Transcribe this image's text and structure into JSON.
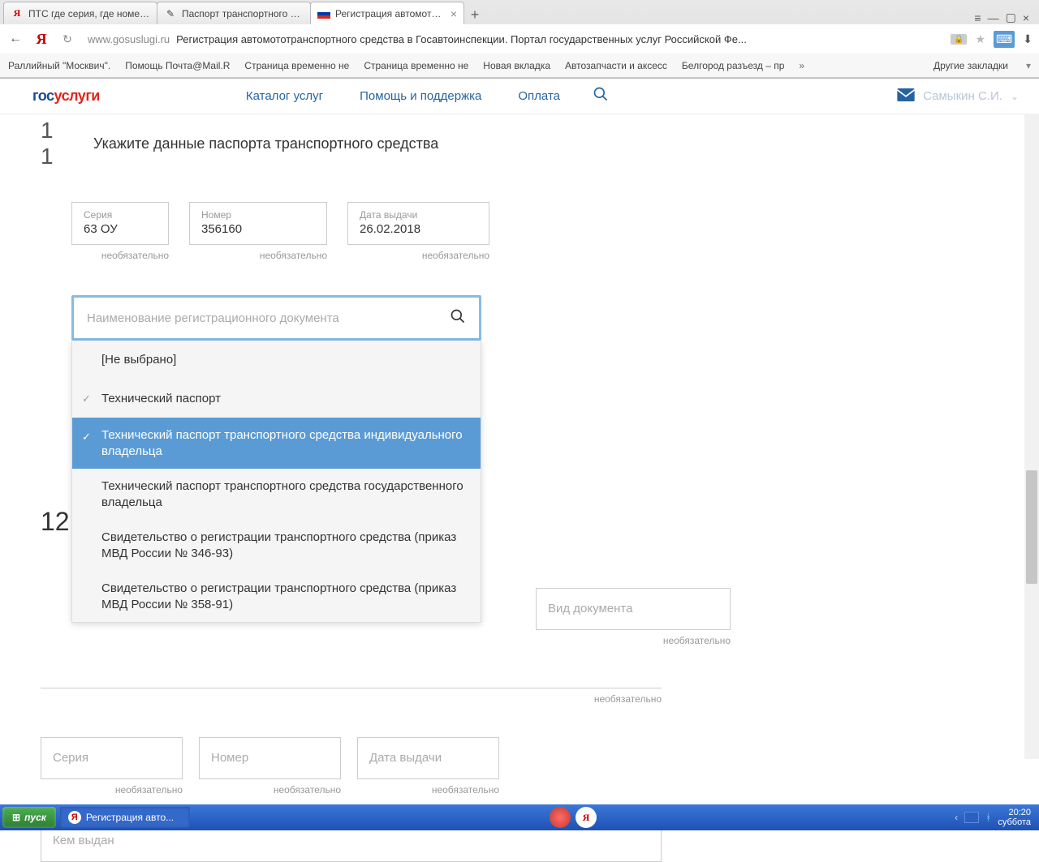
{
  "browser": {
    "tabs": [
      {
        "title": "ПТС где серия, где номер –",
        "favicon": "Я",
        "favColor": "#c00"
      },
      {
        "title": "Паспорт транспортного сре",
        "favicon": "✎",
        "favColor": "#333"
      },
      {
        "title": "Регистрация автомототр",
        "favicon": "🇷🇺",
        "favColor": ""
      }
    ],
    "url_host": "www.gosuslugi.ru",
    "url_title": "Регистрация автомототранспортного средства в Госавтоинспекции. Портал государственных услуг Российской Фе...",
    "bookmarks": [
      "Раллийный \"Москвич\".",
      "Помощь Почта@Mail.R",
      "Страница временно не",
      "Страница временно не",
      "Новая вкладка",
      "Автозапчасти и аксесс",
      "Белгород разъезд – пр"
    ],
    "bookmarks_more": "»",
    "other_bookmarks": "Другие закладки"
  },
  "site": {
    "logo1": "гос",
    "logo2": "услуги",
    "nav": {
      "catalog": "Каталог услуг",
      "help": "Помощь и поддержка",
      "payment": "Оплата"
    },
    "user": "Самыкин С.И."
  },
  "step11": {
    "num": "1 1",
    "title": "Укажите данные паспорта транспортного средства",
    "series_label": "Серия",
    "series_value": "63 ОУ",
    "number_label": "Номер",
    "number_value": "356160",
    "date_label": "Дата выдачи",
    "date_value": "26.02.2018",
    "optional": "необязательно"
  },
  "combo": {
    "placeholder": "Наименование регистрационного документа",
    "options": [
      "[Не выбрано]",
      "Технический паспорт",
      "Технический паспорт транспортного средства индивидуального владельца",
      "Технический паспорт транспортного средства государственного владельца",
      "Свидетельство о регистрации транспортного средства (приказ МВД России № 346-93)",
      "Свидетельство о регистрации транспортного средства (приказ МВД России № 358-91)"
    ],
    "selected_index": 2,
    "check_index": 1
  },
  "step12": {
    "num": "12",
    "doc_type_ph": "Вид документа",
    "series_ph": "Серия",
    "number_ph": "Номер",
    "date_ph": "Дата выдачи",
    "issuer_ph": "Кем выдан",
    "optional": "необязательно"
  },
  "taskbar": {
    "start": "пуск",
    "task": "Регистрация авто...",
    "time": "20:20",
    "day": "суббота"
  }
}
